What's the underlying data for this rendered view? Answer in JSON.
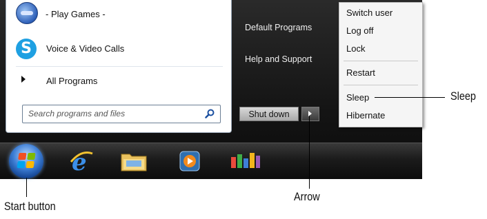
{
  "start_menu": {
    "programs": [
      {
        "label": "- Play Games -",
        "icon": "games-icon"
      },
      {
        "label": "Voice & Video Calls",
        "icon": "skype-icon"
      }
    ],
    "all_programs_label": "All Programs",
    "search": {
      "placeholder": "Search programs and files",
      "icon": "search-icon"
    },
    "right_column": {
      "default_programs": "Default Programs",
      "help_support": "Help and Support"
    },
    "shutdown_label": "Shut down"
  },
  "power_menu": {
    "items": [
      "Switch user",
      "Log off",
      "Lock",
      "Restart",
      "Sleep",
      "Hibernate"
    ]
  },
  "taskbar": {
    "icons": [
      "start-orb-icon",
      "internet-explorer-icon",
      "windows-explorer-icon",
      "media-player-icon",
      "photo-gallery-icon"
    ]
  },
  "callouts": {
    "sleep": "Sleep",
    "arrow": "Arrow",
    "start_button": "Start button"
  },
  "colors": {
    "menu_background": "#f5f5f5",
    "dark_panel": "#151515",
    "accent_blue": "#3e7fd6"
  }
}
